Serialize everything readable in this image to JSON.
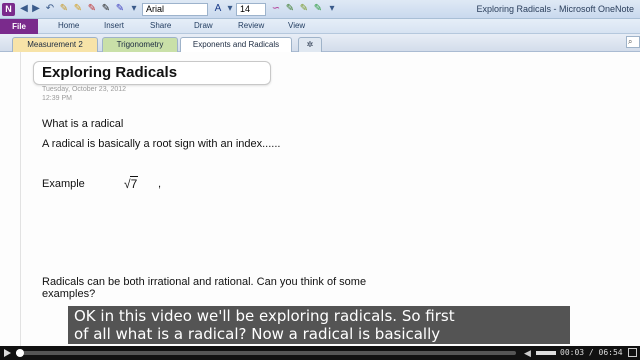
{
  "window": {
    "title": "Exploring Radicals - Microsoft OneNote",
    "app_icon_letter": "N",
    "font_name": "Arial",
    "font_size": "14"
  },
  "quick_access": {
    "icons": [
      "back-icon",
      "forward-icon",
      "undo-icon",
      "pen-icon",
      "highlighter-icon",
      "pen-icon",
      "font-color-icon",
      "dropdown-icon",
      "lasso-icon",
      "pen-icon",
      "pen-icon",
      "dropdown-icon"
    ]
  },
  "ribbon": {
    "tabs": [
      "File",
      "Home",
      "Insert",
      "Share",
      "Draw",
      "Review",
      "View"
    ]
  },
  "sections": {
    "tabs": [
      "Measurement 2",
      "Trigonometry",
      "Exponents and Radicals"
    ],
    "active": "Exponents and Radicals",
    "colors": [
      "#f7e3a8",
      "#c9e0a8",
      "#ffffff"
    ]
  },
  "page": {
    "title": "Exploring Radicals",
    "date": "Tuesday, October 23, 2012",
    "time": "12:39 PM",
    "lines": {
      "q1": "What is a radical",
      "def": "A radical is basically a root sign with an index......",
      "example_label": "Example",
      "example_radical": "√",
      "example_radicand": "7",
      "example_comma": ",",
      "rational_1": "Radicals can be both irrational and rational.   Can you think of some",
      "rational_2": "examples?"
    }
  },
  "caption": {
    "line1": "OK in this video we'll be exploring radicals.  So first",
    "line2": "of all what is a radical? Now a radical is basically"
  },
  "player": {
    "elapsed": "00:03",
    "total": "06:54",
    "time_display": "00:03 / 06:54",
    "progress_fraction": 0.007
  }
}
